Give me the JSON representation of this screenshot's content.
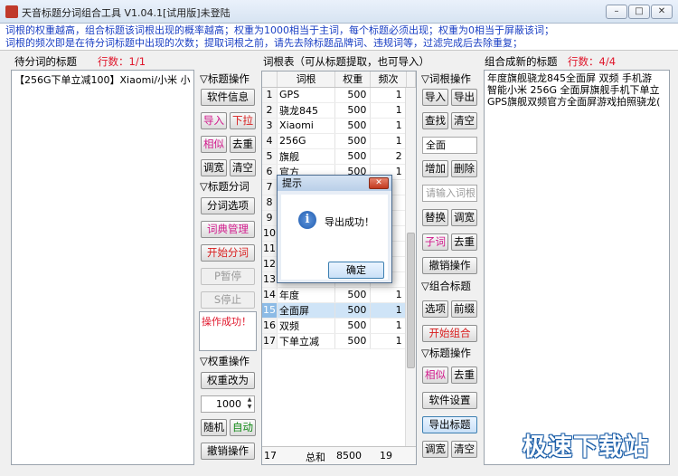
{
  "window": {
    "title": "天音标题分词组合工具 V1.04.1[试用版]未登陆",
    "min": "–",
    "max": "□",
    "close": "✕"
  },
  "notice": [
    "词根的权重越高，组合标题该词根出现的概率越高；权重为1000相当于主词，每个标题必须出现；权重为0相当于屏蔽该词；",
    "词根的频次即是在待分词标题中出现的次数；提取词根之前，请先去除标题品牌词、违规词等，过滤完成后去除重复；"
  ],
  "left_panel": {
    "label": "待分词的标题",
    "count": "行数：1/1",
    "content": "【256G下单立减100】Xiaomi/小米 小"
  },
  "title_ops": {
    "header": "▽标题操作",
    "software_info": "软件信息",
    "import": "导入",
    "dropdown": "下拉",
    "similar": "相似",
    "dedupe": "去重",
    "widen": "调宽",
    "clear": "清空"
  },
  "segment": {
    "header": "▽标题分词",
    "options": "分词选项",
    "dict": "词典管理",
    "start": "开始分词",
    "pause": "P暂停",
    "stop": "S停止",
    "status": "操作成功！"
  },
  "weight_ops": {
    "header": "▽权重操作",
    "change": "权重改为",
    "value": "1000",
    "random": "随机",
    "auto": "自动",
    "undo": "撤销操作"
  },
  "word_table": {
    "label": "词根表（可从标题提取，也可导入）",
    "headers": [
      "",
      "词根",
      "权重",
      "频次"
    ],
    "rows": [
      [
        "1",
        "GPS",
        "500",
        "1"
      ],
      [
        "2",
        "骁龙845",
        "500",
        "1"
      ],
      [
        "3",
        "Xiaomi",
        "500",
        "1"
      ],
      [
        "4",
        "256G",
        "500",
        "1"
      ],
      [
        "5",
        "旗舰",
        "500",
        "2"
      ],
      [
        "6",
        "官方",
        "500",
        "1"
      ],
      [
        "7",
        "",
        "",
        ""
      ],
      [
        "8",
        "",
        "",
        ""
      ],
      [
        "9",
        "",
        "",
        ""
      ],
      [
        "10",
        "",
        "",
        ""
      ],
      [
        "11",
        "",
        "",
        ""
      ],
      [
        "12",
        "",
        "",
        ""
      ],
      [
        "13",
        "",
        "",
        ""
      ],
      [
        "14",
        "年度",
        "500",
        "1"
      ],
      [
        "15",
        "全面屏",
        "500",
        "1"
      ],
      [
        "16",
        "双频",
        "500",
        "1"
      ],
      [
        "17",
        "下单立减",
        "500",
        "1"
      ]
    ],
    "footer": [
      "17",
      "总和",
      "8500",
      "19"
    ]
  },
  "word_ops": {
    "header": "▽词根操作",
    "import": "导入",
    "export": "导出",
    "find": "查找",
    "clear": "清空",
    "search_value": "全面",
    "add": "增加",
    "delete": "删除",
    "input_placeholder": "请输入词根",
    "replace": "替换",
    "widen": "调宽",
    "subword": "子词",
    "dedupe": "去重",
    "undo": "撤销操作"
  },
  "combo_ops": {
    "header": "▽组合标题",
    "options": "选项",
    "prefix": "前缀",
    "start": "开始组合"
  },
  "title_ops2": {
    "header": "▽标题操作",
    "similar": "相似",
    "dedupe": "去重",
    "settings": "软件设置",
    "export": "导出标题",
    "widen": "调宽",
    "clear": "清空"
  },
  "right_panel": {
    "label": "组合成新的标题",
    "count": "行数：4/4",
    "lines": [
      "年度旗舰骁龙845全面屏 双频 手机游",
      "智能小米 256G 全面屏旗舰手机下单立",
      "GPS旗舰双频官方全面屏游戏拍照骁龙("
    ]
  },
  "dialog": {
    "title": "提示",
    "message": "导出成功！",
    "ok": "确定",
    "icon": "i"
  },
  "watermark": "极速下载站"
}
